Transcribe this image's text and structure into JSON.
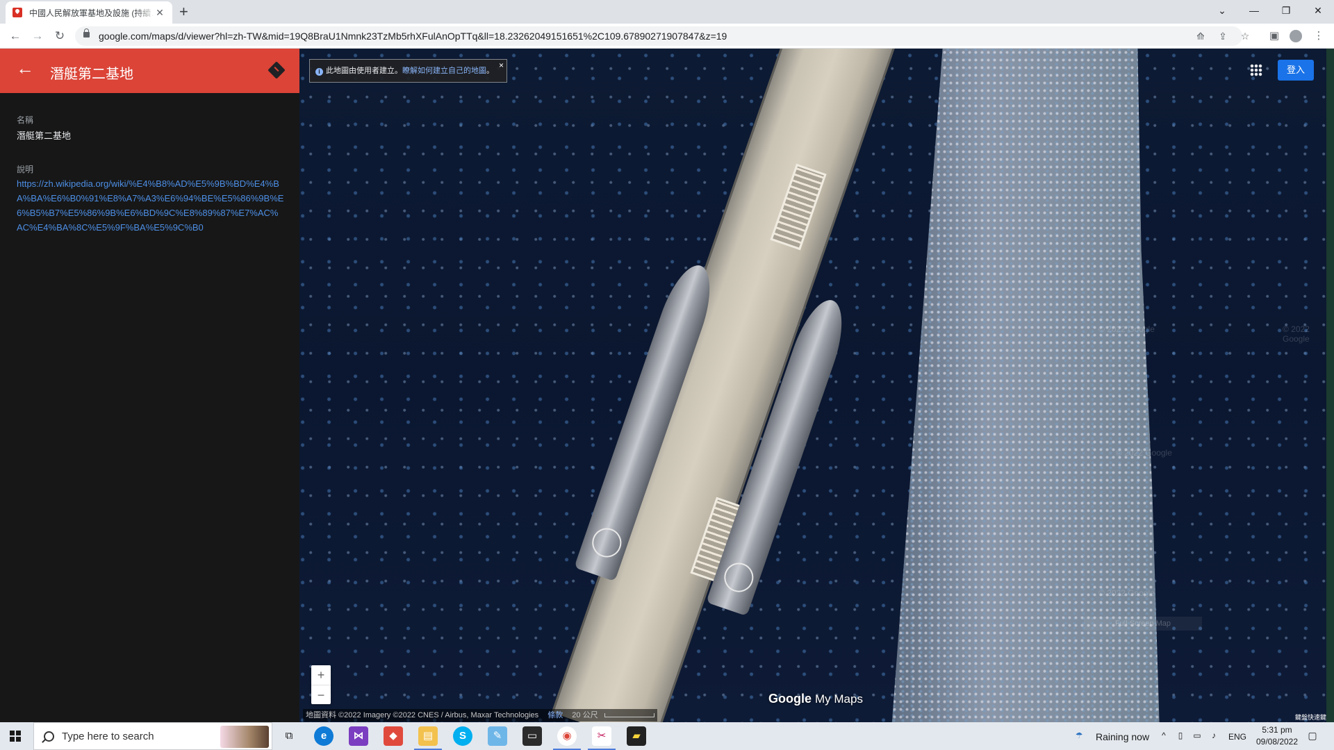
{
  "browser": {
    "tab_title": "中國人民解放軍基地及設施 (持續…",
    "url": "google.com/maps/d/viewer?hl=zh-TW&mid=19Q8BraU1Nmnk23TzMb5rhXFulAnOpTTq&ll=18.23262049151651%2C109.67890271907847&z=19",
    "new_tab_label": "+"
  },
  "panel": {
    "title": "潛艇第二基地",
    "name_label": "名稱",
    "name_value": "潛艇第二基地",
    "desc_label": "說明",
    "desc_link": "https://zh.wikipedia.org/wiki/%E4%B8%AD%E5%9B%BD%E4%BA%BA%E6%B0%91%E8%A7%A3%E6%94%BE%E5%86%9B%E6%B5%B7%E5%86%9B%E6%BD%9C%E8%89%87%E7%AC%AC%E4%BA%8C%E5%9F%BA%E5%9C%B0",
    "accent_color": "#db4437"
  },
  "map": {
    "notice_text": "此地圖由使用者建立。",
    "notice_link": "瞭解如何建立自己的地圖",
    "notice_suffix": "。",
    "signin_label": "登入",
    "zoom_in": "+",
    "zoom_out": "−",
    "logo_google": "Google",
    "logo_mymaps": "My Maps",
    "attribution": "地圖資料 ©2022 Imagery ©2022 CNES / Airbus, Maxar Technologies",
    "terms": "條款",
    "scale_label": "20 公尺",
    "corner_tag": "鍵盤快速鍵",
    "watermarks": [
      "© 2022 Google",
      "© 2022 Google",
      "© 2022 Google",
      "© 2022 Google"
    ],
    "fullscreen_hint": "Full Screen Map"
  },
  "taskbar": {
    "search_placeholder": "Type here to search",
    "weather": "Raining now",
    "lang": "ENG",
    "time": "5:31 pm",
    "date": "09/08/2022"
  }
}
